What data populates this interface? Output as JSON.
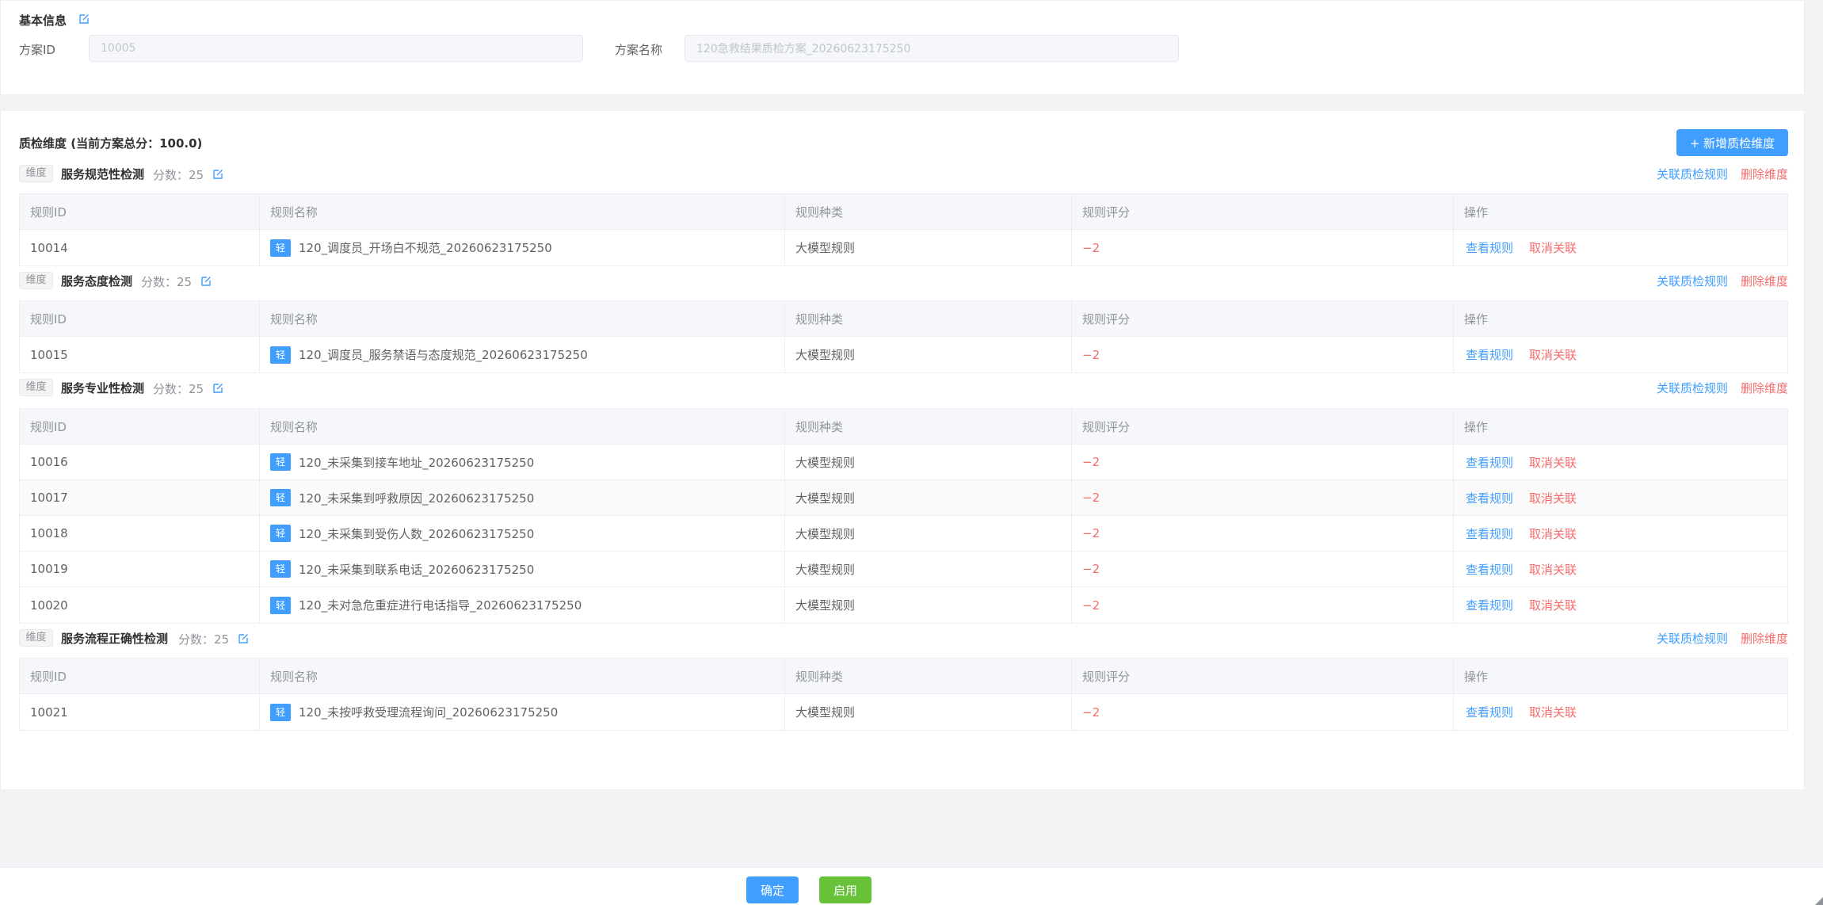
{
  "basic_info": {
    "title": "基本信息",
    "scheme_id_label": "方案ID",
    "scheme_id_value": "10005",
    "scheme_name_label": "方案名称",
    "scheme_name_value": "120急救结果质检方案_20260623175250"
  },
  "dimensions_section": {
    "title": "质检维度 (当前方案总分：100.0)",
    "add_button_label": "+ 新增质检维度",
    "dimension_tag": "维度",
    "score_label": "分数：",
    "link_rules_label": "关联质检规则",
    "delete_dimension_label": "删除维度",
    "columns": [
      "规则ID",
      "规则名称",
      "规则种类",
      "规则评分",
      "操作"
    ],
    "view_rule_label": "查看规则",
    "unlink_label": "取消关联",
    "level_tag": "轻",
    "dimensions": [
      {
        "name": "服务规范性检测",
        "score": "25",
        "rules": [
          {
            "id": "10014",
            "name": "120_调度员_开场白不规范_20260623175250",
            "type": "大模型规则",
            "score": "−2"
          }
        ]
      },
      {
        "name": "服务态度检测",
        "score": "25",
        "rules": [
          {
            "id": "10015",
            "name": "120_调度员_服务禁语与态度规范_20260623175250",
            "type": "大模型规则",
            "score": "−2"
          }
        ]
      },
      {
        "name": "服务专业性检测",
        "score": "25",
        "rules": [
          {
            "id": "10016",
            "name": "120_未采集到接车地址_20260623175250",
            "type": "大模型规则",
            "score": "−2"
          },
          {
            "id": "10017",
            "name": "120_未采集到呼救原因_20260623175250",
            "type": "大模型规则",
            "score": "−2"
          },
          {
            "id": "10018",
            "name": "120_未采集到受伤人数_20260623175250",
            "type": "大模型规则",
            "score": "−2"
          },
          {
            "id": "10019",
            "name": "120_未采集到联系电话_20260623175250",
            "type": "大模型规则",
            "score": "−2"
          },
          {
            "id": "10020",
            "name": "120_未对急危重症进行电话指导_20260623175250",
            "type": "大模型规则",
            "score": "−2"
          }
        ]
      },
      {
        "name": "服务流程正确性检测",
        "score": "25",
        "rules": [
          {
            "id": "10021",
            "name": "120_未按呼救受理流程询问_20260623175250",
            "type": "大模型规则",
            "score": "−2"
          }
        ]
      }
    ]
  },
  "footer": {
    "confirm_label": "确定",
    "enable_label": "启用"
  },
  "colors": {
    "primary": "#409eff",
    "danger": "#f56c6c",
    "success": "#67c23a"
  }
}
